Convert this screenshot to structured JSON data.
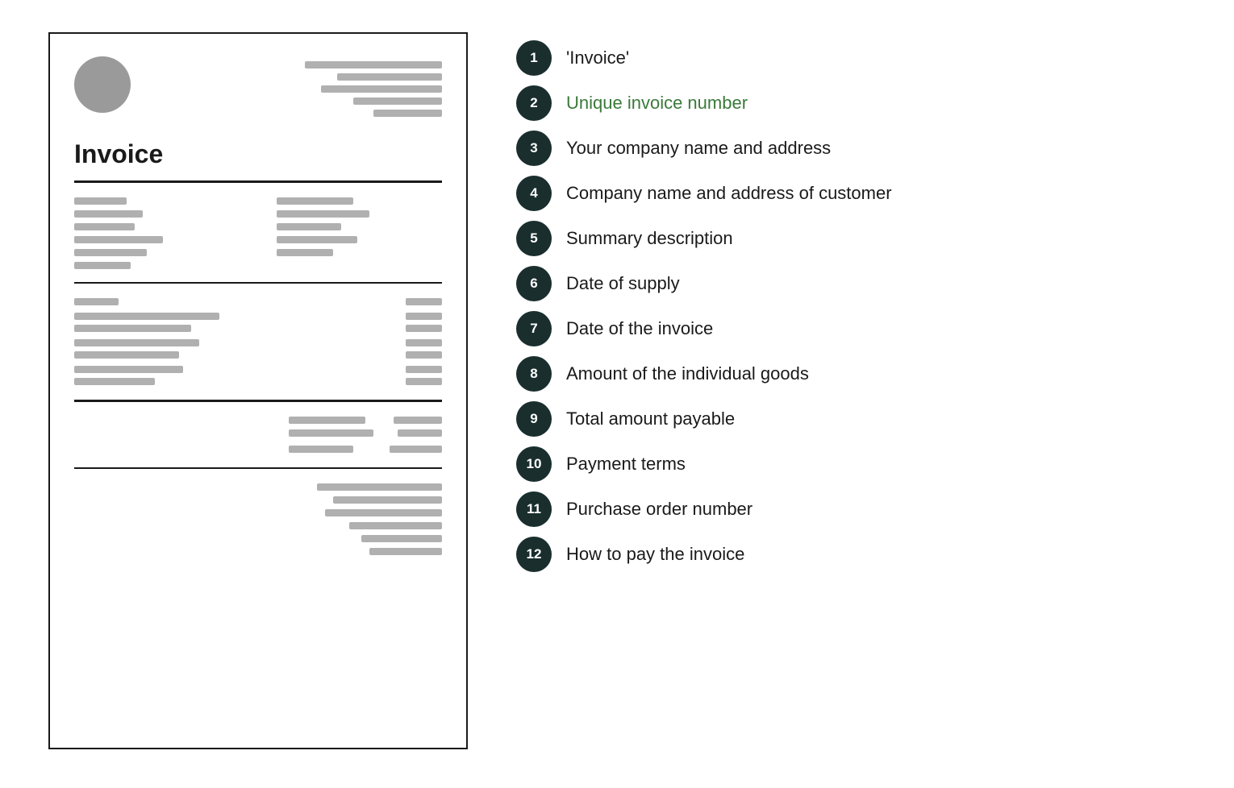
{
  "invoice": {
    "title": "Invoice"
  },
  "legend": {
    "items": [
      {
        "number": "1",
        "label": "'Invoice'"
      },
      {
        "number": "2",
        "label": "Unique invoice number",
        "green": true
      },
      {
        "number": "3",
        "label": "Your company name and address"
      },
      {
        "number": "4",
        "label": "Company name and address of customer"
      },
      {
        "number": "5",
        "label": "Summary description"
      },
      {
        "number": "6",
        "label": "Date of supply"
      },
      {
        "number": "7",
        "label": "Date of the invoice"
      },
      {
        "number": "8",
        "label": "Amount of the individual goods"
      },
      {
        "number": "9",
        "label": "Total amount payable"
      },
      {
        "number": "10",
        "label": "Payment terms"
      },
      {
        "number": "11",
        "label": "Purchase order number"
      },
      {
        "number": "12",
        "label": "How to pay the invoice"
      }
    ]
  }
}
